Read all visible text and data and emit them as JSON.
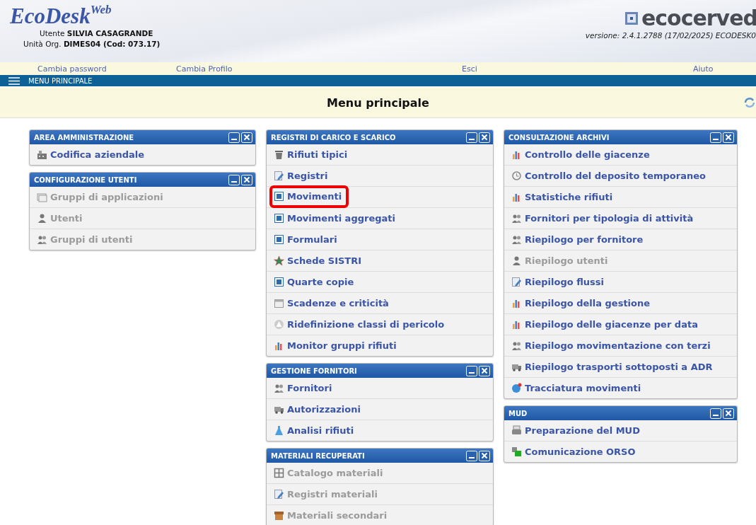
{
  "header": {
    "logo": "EcoDesk$^{Web}$",
    "user_line": "Utente **SILVIA CASAGRANDE**",
    "org_line": "Unità Org. **DIMES04 (Cod: 073.17)**",
    "brand": "ecocerved",
    "version": "versione: 2.4.1.2788 (17/02/2025) ECODESK0"
  },
  "links": [
    "Cambia password",
    "Cambia Profilo",
    "Esci",
    "Aiuto"
  ],
  "menu_bar": {
    "label": "MENU PRINCIPALE"
  },
  "page_title": "Menu principale",
  "columns": [
    {
      "panels": [
        {
          "title": "AREA AMMINISTRAZIONE",
          "items": [
            {
              "label": "Codifica aziendale",
              "disabled": false,
              "highlighted": false
            }
          ]
        },
        {
          "title": "CONFIGURAZIONE UTENTI",
          "items": [
            {
              "label": "Gruppi di applicazioni",
              "disabled": true,
              "highlighted": false
            },
            {
              "label": "Utenti",
              "disabled": true,
              "highlighted": false
            },
            {
              "label": "Gruppi di utenti",
              "disabled": true,
              "highlighted": false
            }
          ]
        }
      ]
    },
    {
      "panels": [
        {
          "title": "REGISTRI DI CARICO E SCARICO",
          "items": [
            {
              "label": "Rifiuti tipici",
              "disabled": false,
              "highlighted": false
            },
            {
              "label": "Registri",
              "disabled": false,
              "highlighted": false
            },
            {
              "label": "Movimenti",
              "disabled": false,
              "highlighted": true
            },
            {
              "label": "Movimenti aggregati",
              "disabled": false,
              "highlighted": false
            },
            {
              "label": "Formulari",
              "disabled": false,
              "highlighted": false
            },
            {
              "label": "Schede SISTRI",
              "disabled": false,
              "highlighted": false
            },
            {
              "label": "Quarte copie",
              "disabled": false,
              "highlighted": false
            },
            {
              "label": "Scadenze e criticità",
              "disabled": false,
              "highlighted": false
            },
            {
              "label": "Ridefinizione classi di pericolo",
              "disabled": false,
              "highlighted": false
            },
            {
              "label": "Monitor gruppi rifiuti",
              "disabled": false,
              "highlighted": false
            }
          ]
        },
        {
          "title": "GESTIONE FORNITORI",
          "items": [
            {
              "label": "Fornitori",
              "disabled": false,
              "highlighted": false
            },
            {
              "label": "Autorizzazioni",
              "disabled": false,
              "highlighted": false
            },
            {
              "label": "Analisi rifiuti",
              "disabled": false,
              "highlighted": false
            }
          ]
        },
        {
          "title": "MATERIALI RECUPERATI",
          "items": [
            {
              "label": "Catalogo materiali",
              "disabled": true,
              "highlighted": false
            },
            {
              "label": "Registri materiali",
              "disabled": true,
              "highlighted": false
            },
            {
              "label": "Materiali secondari",
              "disabled": true,
              "highlighted": false
            }
          ]
        }
      ]
    },
    {
      "panels": [
        {
          "title": "CONSULTAZIONE ARCHIVI",
          "items": [
            {
              "label": "Controllo delle giacenze",
              "disabled": false,
              "highlighted": false
            },
            {
              "label": "Controllo del deposito temporaneo",
              "disabled": false,
              "highlighted": false
            },
            {
              "label": "Statistiche rifiuti",
              "disabled": false,
              "highlighted": false
            },
            {
              "label": "Fornitori per tipologia di attività",
              "disabled": false,
              "highlighted": false
            },
            {
              "label": "Riepilogo per fornitore",
              "disabled": false,
              "highlighted": false
            },
            {
              "label": "Riepilogo utenti",
              "disabled": true,
              "highlighted": false
            },
            {
              "label": "Riepilogo flussi",
              "disabled": false,
              "highlighted": false
            },
            {
              "label": "Riepilogo della gestione",
              "disabled": false,
              "highlighted": false
            },
            {
              "label": "Riepilogo delle giacenze per data",
              "disabled": false,
              "highlighted": false
            },
            {
              "label": "Riepilogo movimentazione con terzi",
              "disabled": false,
              "highlighted": false
            },
            {
              "label": "Riepilogo trasporti sottoposti a ADR",
              "disabled": false,
              "highlighted": false
            },
            {
              "label": "Tracciatura movimenti",
              "disabled": false,
              "highlighted": false
            }
          ]
        },
        {
          "title": "MUD",
          "items": [
            {
              "label": "Preparazione del MUD",
              "disabled": false,
              "highlighted": false
            },
            {
              "label": "Comunicazione ORSO",
              "disabled": false,
              "highlighted": false
            }
          ]
        }
      ]
    }
  ]
}
